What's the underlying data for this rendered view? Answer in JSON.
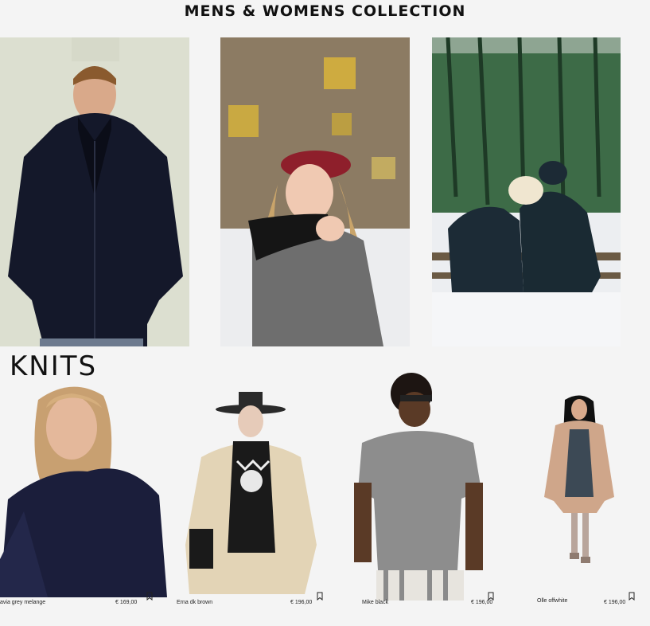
{
  "header": {
    "title": "MENS & WOMENS COLLECTION"
  },
  "section": {
    "title": "KNITS"
  },
  "hero_images": [
    {
      "name": "mens-black-parka-photo"
    },
    {
      "name": "woman-red-beret-photo"
    },
    {
      "name": "couple-in-snow-photo"
    }
  ],
  "products": [
    {
      "name": "avia grey melange",
      "currency": "€",
      "price": "169,00",
      "icon": "bookmark-icon"
    },
    {
      "name": "Erna dk brown",
      "currency": "€",
      "price": "196,00",
      "icon": "bookmark-icon"
    },
    {
      "name": "Mike black",
      "currency": "€",
      "price": "196,00",
      "icon": "bookmark-icon"
    },
    {
      "name": "Olle offwhite",
      "currency": "€",
      "price": "196,00",
      "icon": "bookmark-icon"
    }
  ]
}
